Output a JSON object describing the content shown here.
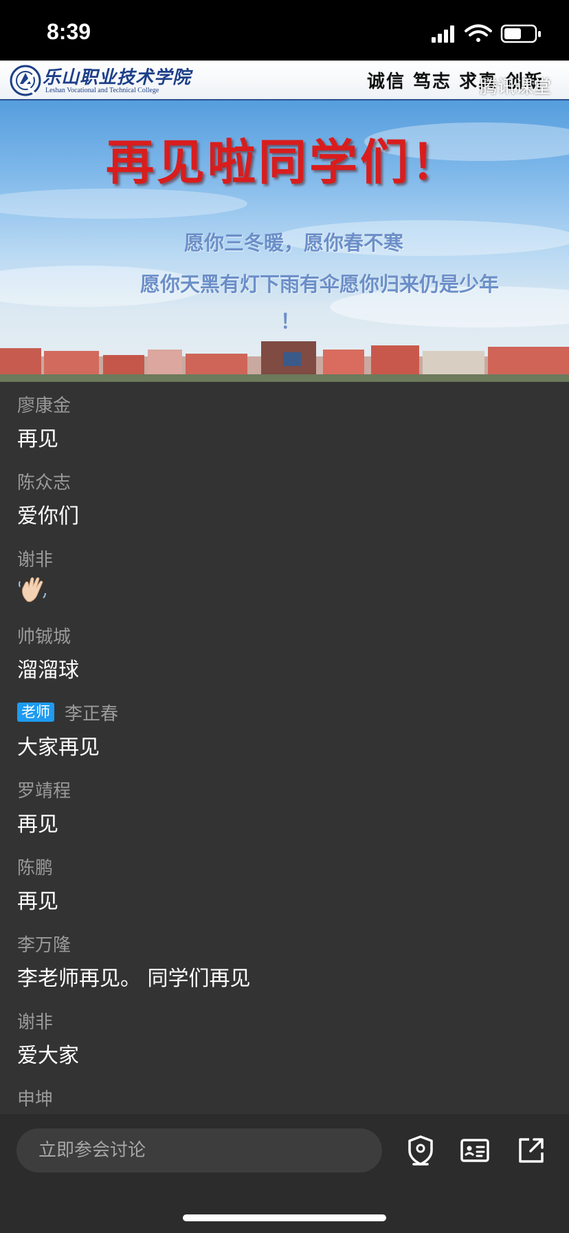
{
  "status_bar": {
    "time": "8:39"
  },
  "slide": {
    "college_name_cn": "乐山职业技术学院",
    "college_name_en": "Leshan Vocational and Technical College",
    "motto": "诚信 笃志 求真 创新",
    "brand_watermark": "腾讯课堂",
    "title": "再见啦同学们！",
    "line1": "愿你三冬暖，愿你春不寒",
    "line2": "愿你天黑有灯下雨有伞愿你归来仍是少年",
    "line2_end": "！"
  },
  "messages": [
    {
      "name": "廖康金",
      "text": "再见"
    },
    {
      "name": "陈众志",
      "text": "爱你们"
    },
    {
      "name": "谢非",
      "emoji": "waving-hand"
    },
    {
      "name": "帅铖城",
      "text": "溜溜球"
    },
    {
      "badge": "老师",
      "name": "李正春",
      "text": "大家再见"
    },
    {
      "name": "罗靖程",
      "text": "再见"
    },
    {
      "name": "陈鹏",
      "text": "再见"
    },
    {
      "name": "李万隆",
      "text": "李老师再见。 同学们再见"
    },
    {
      "name": "谢非",
      "text": "爱大家"
    },
    {
      "name": "申坤",
      "text": ""
    }
  ],
  "bottom_bar": {
    "placeholder": "立即参会讨论"
  },
  "colors": {
    "background": "#333333",
    "bottom_bar": "#2c2c2c",
    "teacher_badge": "#1e9bf0",
    "slide_title": "#d91d1d"
  }
}
